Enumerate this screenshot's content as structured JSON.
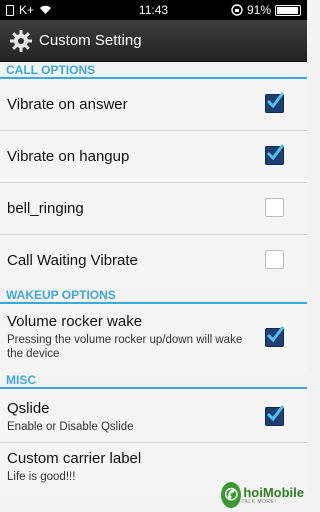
{
  "status": {
    "carrier": "K+",
    "time": "11:43",
    "battery": "91%"
  },
  "app": {
    "title": "Custom Setting"
  },
  "sections": [
    {
      "header": "CALL OPTIONS",
      "items": [
        {
          "label": "Vibrate on answer",
          "checked": true
        },
        {
          "label": "Vibrate on hangup",
          "checked": true
        },
        {
          "label": "bell_ringing",
          "checked": false
        },
        {
          "label": "Call Waiting Vibrate",
          "checked": false
        }
      ]
    },
    {
      "header": "WAKEUP OPTIONS",
      "items": [
        {
          "label": "Volume rocker wake",
          "summary": "Pressing the volume rocker up/down will wake the device",
          "checked": true
        }
      ]
    },
    {
      "header": "MISC",
      "items": [
        {
          "label": "Qslide",
          "summary": "Enable or Disable Qslide",
          "checked": true
        },
        {
          "label": "Custom carrier label",
          "summary": "Life is good!!!"
        }
      ]
    }
  ],
  "watermark": {
    "brand": "hoiMobile",
    "tagline": "TALK MORE!"
  },
  "colors": {
    "accent": "#3ea9d8",
    "actionbar": "#2a2a2a",
    "checkbox_checked": "#1f3f74"
  }
}
